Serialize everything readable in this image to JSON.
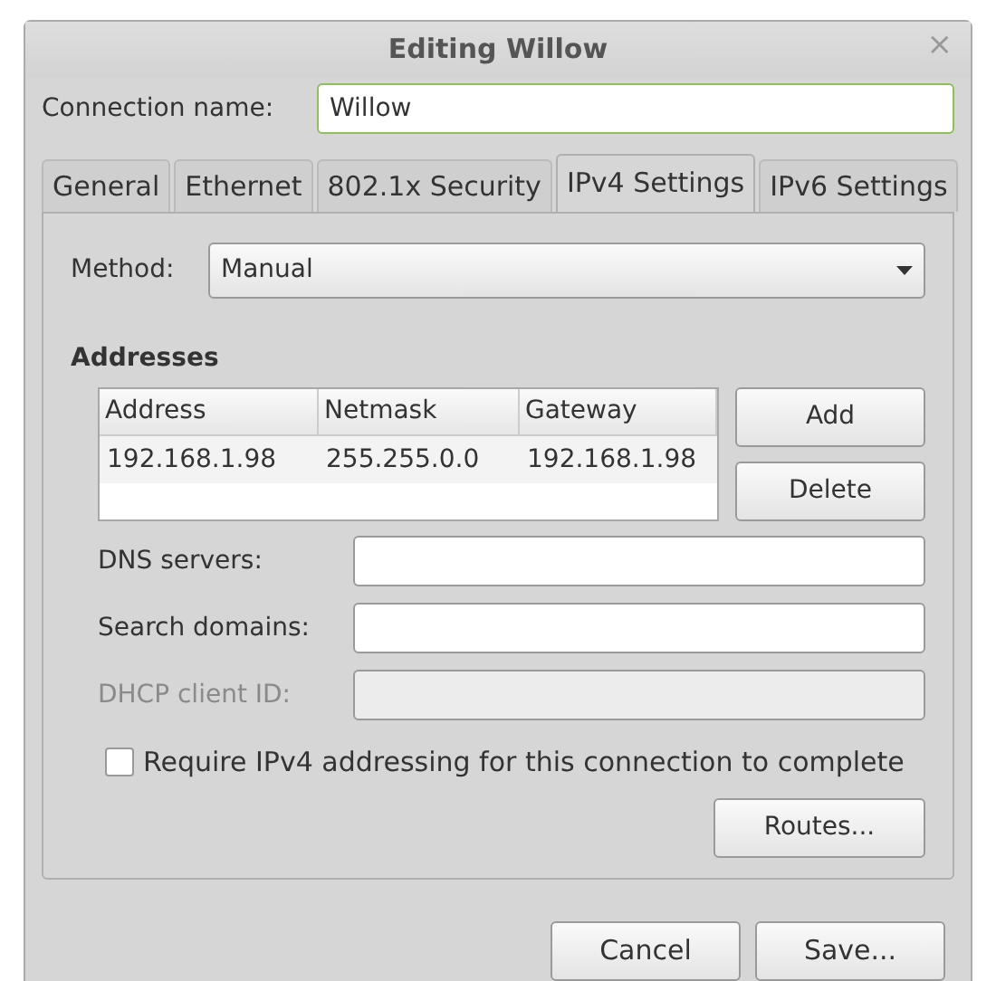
{
  "window": {
    "title": "Editing Willow",
    "close": "×"
  },
  "connection_name": {
    "label": "Connection name:",
    "value": "Willow"
  },
  "tabs": [
    {
      "label": "General",
      "selected": false
    },
    {
      "label": "Ethernet",
      "selected": false
    },
    {
      "label": "802.1x Security",
      "selected": false
    },
    {
      "label": "IPv4 Settings",
      "selected": true
    },
    {
      "label": "IPv6 Settings",
      "selected": false
    }
  ],
  "method": {
    "label": "Method:",
    "value": "Manual"
  },
  "addresses": {
    "title": "Addresses",
    "columns": [
      "Address",
      "Netmask",
      "Gateway"
    ],
    "rows": [
      [
        "192.168.1.98",
        "255.255.0.0",
        "192.168.1.98"
      ]
    ],
    "buttons": [
      "Add",
      "Delete"
    ]
  },
  "fields": [
    {
      "label": "DNS servers:",
      "disabled": false
    },
    {
      "label": "Search domains:",
      "disabled": false
    },
    {
      "label": "DHCP client ID:",
      "disabled": true
    }
  ],
  "require_ipv4": {
    "label": "Require IPv4 addressing for this connection to complete",
    "checked": false
  },
  "routes_button": "Routes...",
  "buttons": [
    "Cancel",
    "Save..."
  ]
}
